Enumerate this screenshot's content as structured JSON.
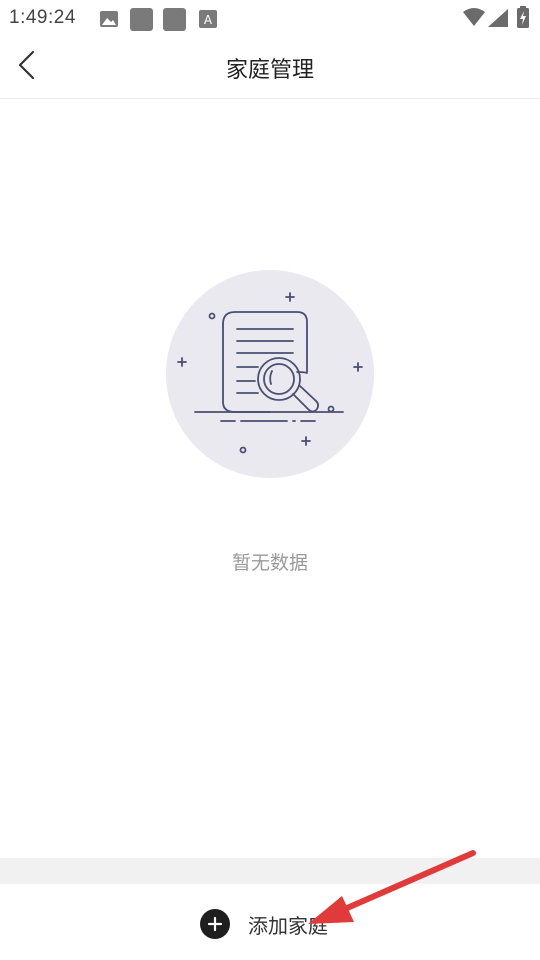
{
  "status_bar": {
    "time": "1:49:24",
    "icons": [
      "image-icon",
      "app-square-icon",
      "app-square-icon",
      "font-a-icon",
      "wifi-icon",
      "signal-icon",
      "battery-charging-icon"
    ]
  },
  "header": {
    "title": "家庭管理",
    "back_icon": "chevron-left-icon"
  },
  "empty_state": {
    "illustration": "document-search-icon",
    "text": "暂无数据"
  },
  "bottom": {
    "add_label": "添加家庭",
    "add_icon": "plus-circle-icon"
  },
  "colors": {
    "illustration_bg": "#e9e9ef",
    "illustration_stroke": "#4a4f73",
    "annotation_arrow": "#e03a3a"
  }
}
